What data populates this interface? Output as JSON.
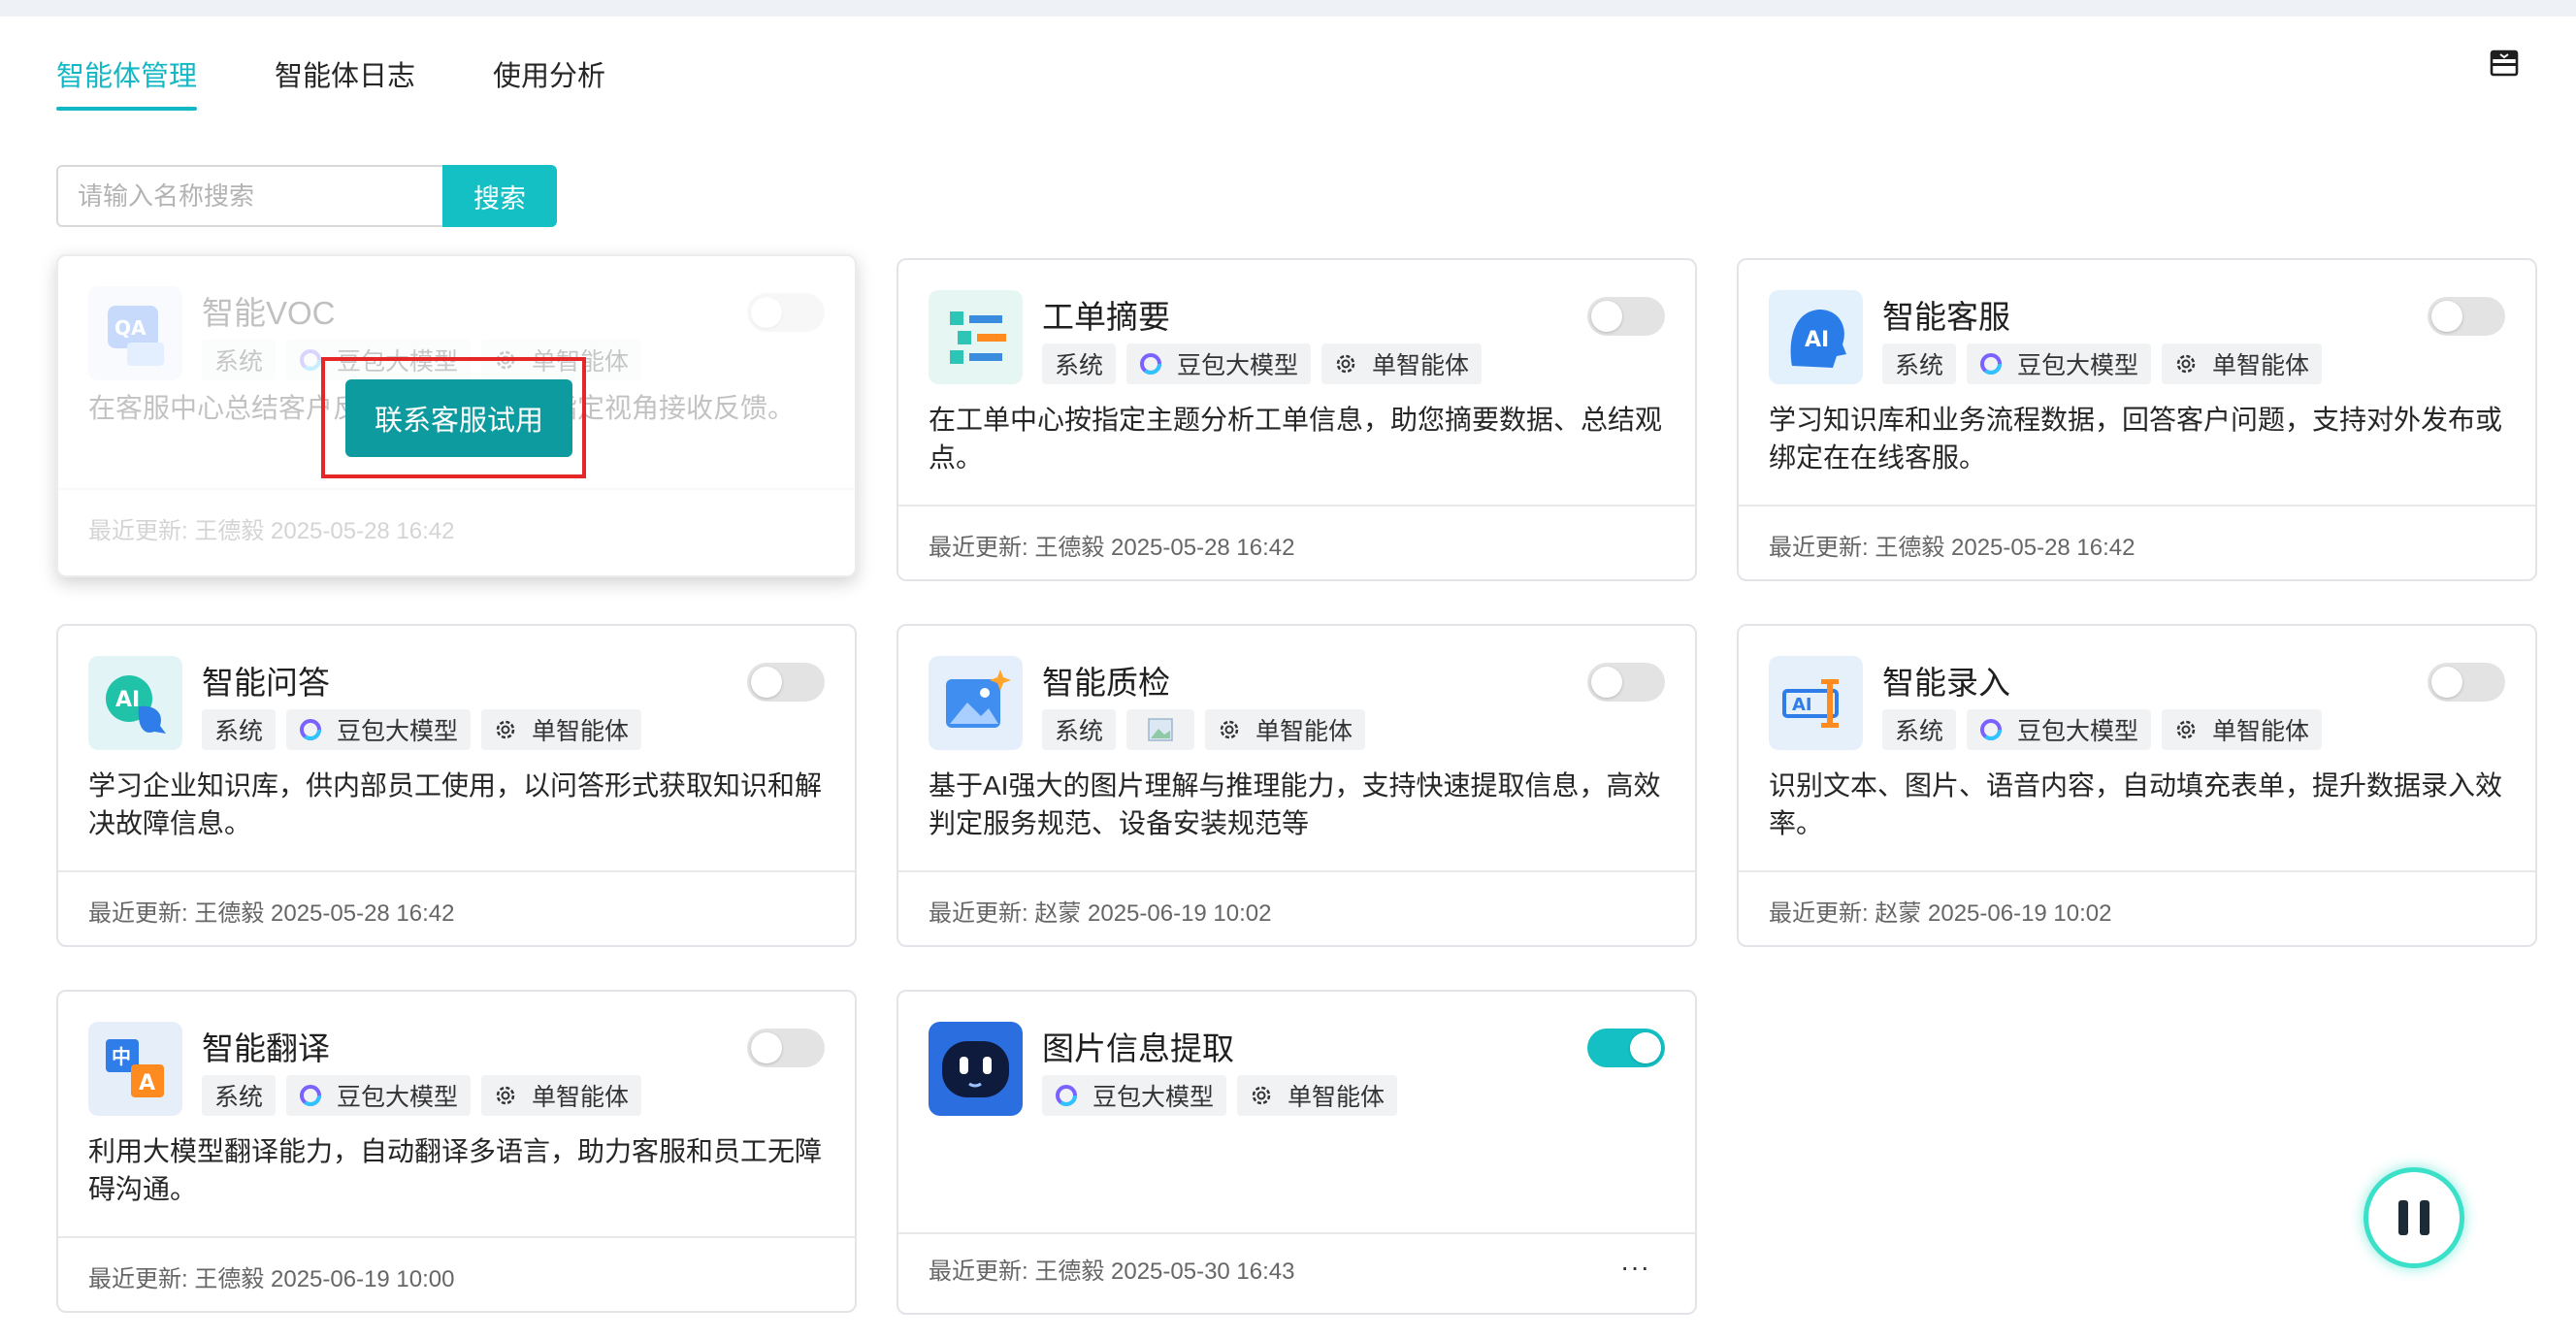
{
  "tabs": [
    {
      "label": "智能体管理",
      "active": true
    },
    {
      "label": "智能体日志",
      "active": false
    },
    {
      "label": "使用分析",
      "active": false
    }
  ],
  "search": {
    "placeholder": "请输入名称搜索",
    "button_label": "搜索"
  },
  "overlay": {
    "contact_button_label": "联系客服试用"
  },
  "cards": [
    {
      "title": "智能VOC",
      "tags": [
        "系统",
        "豆包大模型",
        "单智能体"
      ],
      "description": "在客服中心总结客户反馈，以便企业从指定视角接收反馈。",
      "updated": "最近更新: 王德毅 2025-05-28 16:42",
      "enabled": false,
      "icon": "qa-doc-icon"
    },
    {
      "title": "工单摘要",
      "tags": [
        "系统",
        "豆包大模型",
        "单智能体"
      ],
      "description": "在工单中心按指定主题分析工单信息，助您摘要数据、总结观点。",
      "updated": "最近更新: 王德毅 2025-05-28 16:42",
      "enabled": false,
      "icon": "list-summary-icon"
    },
    {
      "title": "智能客服",
      "tags": [
        "系统",
        "豆包大模型",
        "单智能体"
      ],
      "description": "学习知识库和业务流程数据，回答客户问题，支持对外发布或绑定在在线客服。",
      "updated": "最近更新: 王德毅 2025-05-28 16:42",
      "enabled": false,
      "icon": "ai-head-icon"
    },
    {
      "title": "智能问答",
      "tags": [
        "系统",
        "豆包大模型",
        "单智能体"
      ],
      "description": "学习企业知识库，供内部员工使用，以问答形式获取知识和解决故障信息。",
      "updated": "最近更新: 王德毅 2025-05-28 16:42",
      "enabled": false,
      "icon": "ai-chat-icon"
    },
    {
      "title": "智能质检",
      "tags": [
        "系统",
        "",
        "单智能体"
      ],
      "description": "基于AI强大的图片理解与推理能力，支持快速提取信息，高效判定服务规范、设备安装规范等",
      "updated": "最近更新: 赵蒙 2025-06-19 10:02",
      "enabled": false,
      "icon": "image-sparkle-icon"
    },
    {
      "title": "智能录入",
      "tags": [
        "系统",
        "豆包大模型",
        "单智能体"
      ],
      "description": "识别文本、图片、语音内容，自动填充表单，提升数据录入效率。",
      "updated": "最近更新: 赵蒙 2025-06-19 10:02",
      "enabled": false,
      "icon": "ai-input-icon"
    },
    {
      "title": "智能翻译",
      "tags": [
        "系统",
        "豆包大模型",
        "单智能体"
      ],
      "description": "利用大模型翻译能力，自动翻译多语言，助力客服和员工无障碍沟通。",
      "updated": "最近更新: 王德毅 2025-06-19 10:00",
      "enabled": false,
      "icon": "translate-icon"
    },
    {
      "title": "图片信息提取",
      "tags": [
        "豆包大模型",
        "单智能体"
      ],
      "description": "",
      "updated": "最近更新: 王德毅 2025-05-30 16:43",
      "enabled": true,
      "icon": "robot-face-icon",
      "more_label": "···"
    }
  ],
  "colors": {
    "accent": "#14c0c4",
    "overlay_button": "#0e9b9f",
    "highlight_box": "#e62727"
  }
}
